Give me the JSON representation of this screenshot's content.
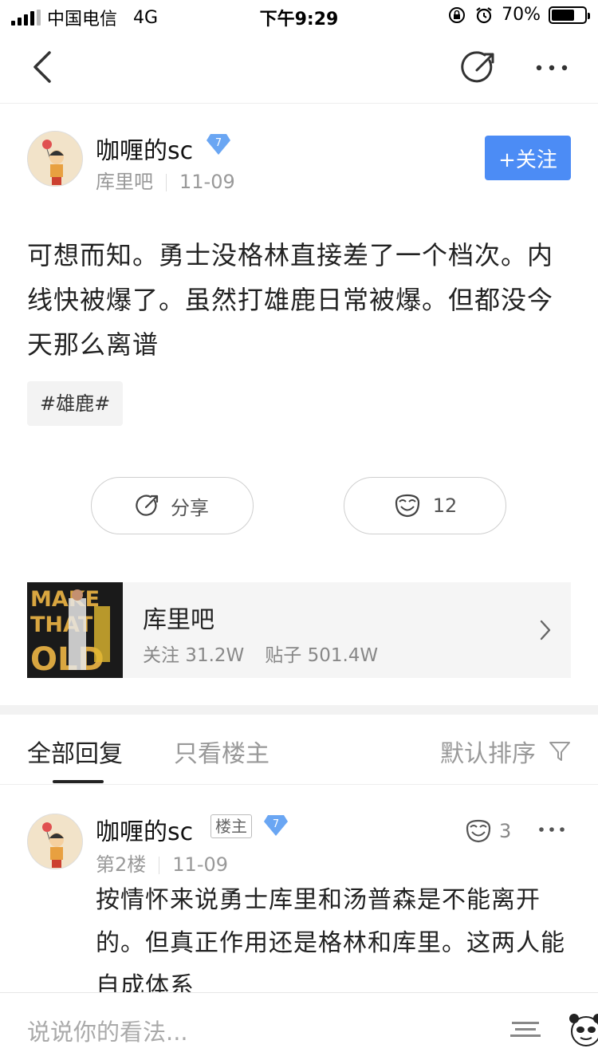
{
  "status": {
    "carrier": "中国电信",
    "network": "4G",
    "time": "下午9:29",
    "battery": "70%",
    "battery_level": 0.7
  },
  "post": {
    "author": "咖喱的sc",
    "level": "7",
    "forum": "库里吧",
    "date": "11-09",
    "follow_label": "+关注",
    "text": "可想而知。勇士没格林直接差了一个档次。内线快被爆了。虽然打雄鹿日常被爆。但都没今天那么离谱",
    "tag": "#雄鹿#",
    "share_label": "分享",
    "like_count": "12"
  },
  "forum_card": {
    "name": "库里吧",
    "followers": "关注 31.2W",
    "posts": "贴子 501.4W",
    "image_text": [
      "MAKE",
      "THAT",
      "OLD"
    ]
  },
  "tabs": {
    "all": "全部回复",
    "op_only": "只看楼主",
    "sort": "默认排序"
  },
  "reply": {
    "author": "咖喱的sc",
    "badge": "楼主",
    "level": "7",
    "floor": "第2楼",
    "date": "11-09",
    "like_count": "3",
    "text": "按情怀来说勇士库里和汤普森是不能离开的。但真正作用还是格林和库里。这两人能自成体系"
  },
  "bottom": {
    "placeholder": "说说你的看法..."
  },
  "colors": {
    "accent": "#4c8cf5",
    "level_badge": "#6aa6f3"
  }
}
